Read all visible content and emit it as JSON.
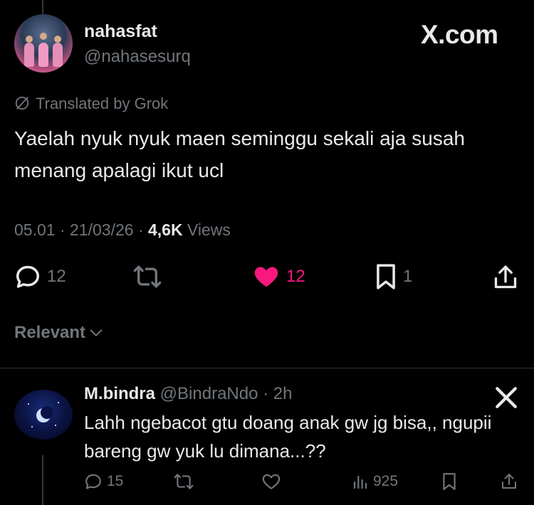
{
  "main_tweet": {
    "display_name": "nahasfat",
    "handle": "@nahasesurq",
    "watermark": "X.com",
    "translated_label": "Translated by Grok",
    "text": "Yaelah nyuk nyuk maen seminggu sekali aja susah menang apalagi ikut ucl",
    "time": "05.01",
    "date": "21/03/26",
    "views_count": "4,6K",
    "views_label": "Views",
    "replies": "12",
    "likes": "12",
    "bookmarks": "1",
    "like_color": "#f91880"
  },
  "sort": {
    "label": "Relevant"
  },
  "reply": {
    "display_name": "M.bindra",
    "handle": "@BindraNdo",
    "age": "2h",
    "text": "Lahh ngebacot gtu doang anak gw jg bisa,, ngupii bareng gw yuk lu dimana...??",
    "replies": "15",
    "views": "925"
  },
  "icons": {
    "reply": "reply-icon",
    "retweet": "retweet-icon",
    "like": "heart-icon",
    "bookmark": "bookmark-icon",
    "share": "share-icon",
    "views": "views-icon",
    "grok": "grok-icon",
    "x_logo": "x-logo-icon",
    "chevron": "chevron-down-icon"
  },
  "colors": {
    "background": "#000000",
    "text": "#e7e9ea",
    "muted": "#71767b",
    "like": "#f91880"
  }
}
